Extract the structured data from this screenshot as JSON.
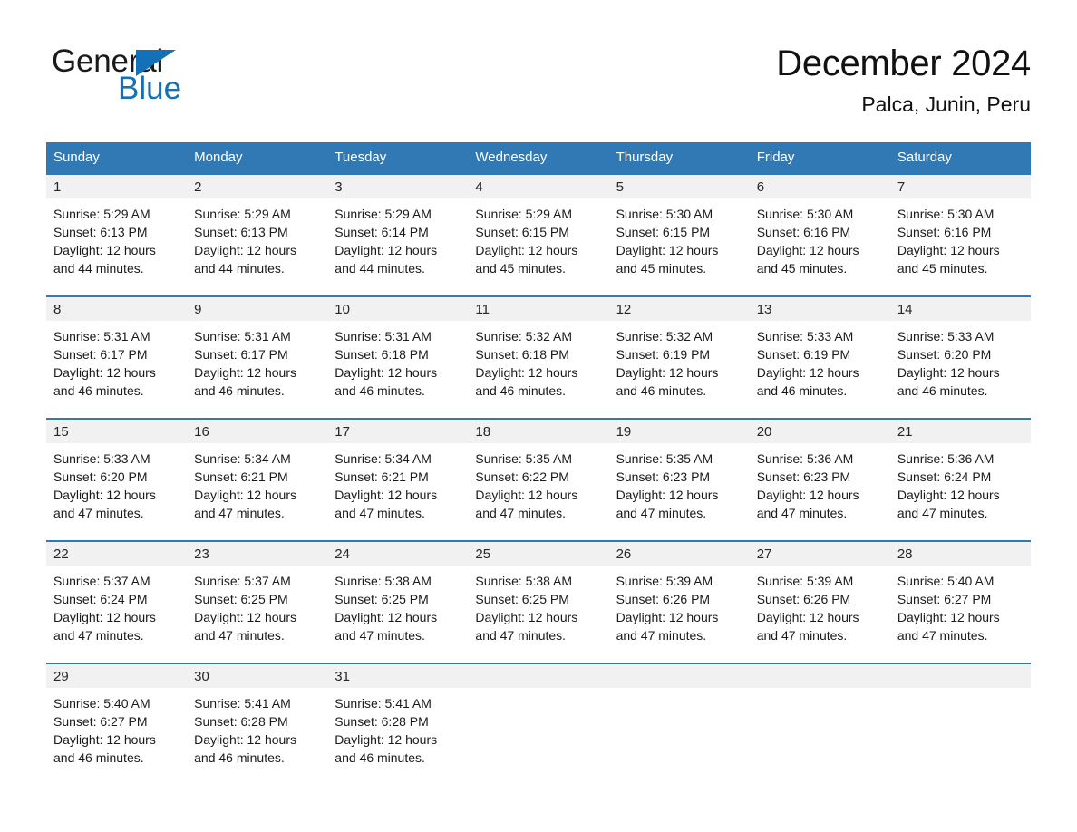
{
  "brand": {
    "name_part1": "General",
    "name_part2": "Blue",
    "triangle_color": "#1371b8",
    "text_color": "#1a1a1a"
  },
  "header": {
    "title": "December 2024",
    "subtitle": "Palca, Junin, Peru"
  },
  "theme": {
    "header_blue": "#3179b5",
    "daynum_band_gray": "#f1f1f1",
    "page_background": "#ffffff",
    "text_color": "#1a1a1a"
  },
  "weekday_headers": [
    "Sunday",
    "Monday",
    "Tuesday",
    "Wednesday",
    "Thursday",
    "Friday",
    "Saturday"
  ],
  "weeks": [
    [
      {
        "day": "1",
        "sunrise": "Sunrise: 5:29 AM",
        "sunset": "Sunset: 6:13 PM",
        "daylight_line1": "Daylight: 12 hours",
        "daylight_line2": "and 44 minutes."
      },
      {
        "day": "2",
        "sunrise": "Sunrise: 5:29 AM",
        "sunset": "Sunset: 6:13 PM",
        "daylight_line1": "Daylight: 12 hours",
        "daylight_line2": "and 44 minutes."
      },
      {
        "day": "3",
        "sunrise": "Sunrise: 5:29 AM",
        "sunset": "Sunset: 6:14 PM",
        "daylight_line1": "Daylight: 12 hours",
        "daylight_line2": "and 44 minutes."
      },
      {
        "day": "4",
        "sunrise": "Sunrise: 5:29 AM",
        "sunset": "Sunset: 6:15 PM",
        "daylight_line1": "Daylight: 12 hours",
        "daylight_line2": "and 45 minutes."
      },
      {
        "day": "5",
        "sunrise": "Sunrise: 5:30 AM",
        "sunset": "Sunset: 6:15 PM",
        "daylight_line1": "Daylight: 12 hours",
        "daylight_line2": "and 45 minutes."
      },
      {
        "day": "6",
        "sunrise": "Sunrise: 5:30 AM",
        "sunset": "Sunset: 6:16 PM",
        "daylight_line1": "Daylight: 12 hours",
        "daylight_line2": "and 45 minutes."
      },
      {
        "day": "7",
        "sunrise": "Sunrise: 5:30 AM",
        "sunset": "Sunset: 6:16 PM",
        "daylight_line1": "Daylight: 12 hours",
        "daylight_line2": "and 45 minutes."
      }
    ],
    [
      {
        "day": "8",
        "sunrise": "Sunrise: 5:31 AM",
        "sunset": "Sunset: 6:17 PM",
        "daylight_line1": "Daylight: 12 hours",
        "daylight_line2": "and 46 minutes."
      },
      {
        "day": "9",
        "sunrise": "Sunrise: 5:31 AM",
        "sunset": "Sunset: 6:17 PM",
        "daylight_line1": "Daylight: 12 hours",
        "daylight_line2": "and 46 minutes."
      },
      {
        "day": "10",
        "sunrise": "Sunrise: 5:31 AM",
        "sunset": "Sunset: 6:18 PM",
        "daylight_line1": "Daylight: 12 hours",
        "daylight_line2": "and 46 minutes."
      },
      {
        "day": "11",
        "sunrise": "Sunrise: 5:32 AM",
        "sunset": "Sunset: 6:18 PM",
        "daylight_line1": "Daylight: 12 hours",
        "daylight_line2": "and 46 minutes."
      },
      {
        "day": "12",
        "sunrise": "Sunrise: 5:32 AM",
        "sunset": "Sunset: 6:19 PM",
        "daylight_line1": "Daylight: 12 hours",
        "daylight_line2": "and 46 minutes."
      },
      {
        "day": "13",
        "sunrise": "Sunrise: 5:33 AM",
        "sunset": "Sunset: 6:19 PM",
        "daylight_line1": "Daylight: 12 hours",
        "daylight_line2": "and 46 minutes."
      },
      {
        "day": "14",
        "sunrise": "Sunrise: 5:33 AM",
        "sunset": "Sunset: 6:20 PM",
        "daylight_line1": "Daylight: 12 hours",
        "daylight_line2": "and 46 minutes."
      }
    ],
    [
      {
        "day": "15",
        "sunrise": "Sunrise: 5:33 AM",
        "sunset": "Sunset: 6:20 PM",
        "daylight_line1": "Daylight: 12 hours",
        "daylight_line2": "and 47 minutes."
      },
      {
        "day": "16",
        "sunrise": "Sunrise: 5:34 AM",
        "sunset": "Sunset: 6:21 PM",
        "daylight_line1": "Daylight: 12 hours",
        "daylight_line2": "and 47 minutes."
      },
      {
        "day": "17",
        "sunrise": "Sunrise: 5:34 AM",
        "sunset": "Sunset: 6:21 PM",
        "daylight_line1": "Daylight: 12 hours",
        "daylight_line2": "and 47 minutes."
      },
      {
        "day": "18",
        "sunrise": "Sunrise: 5:35 AM",
        "sunset": "Sunset: 6:22 PM",
        "daylight_line1": "Daylight: 12 hours",
        "daylight_line2": "and 47 minutes."
      },
      {
        "day": "19",
        "sunrise": "Sunrise: 5:35 AM",
        "sunset": "Sunset: 6:23 PM",
        "daylight_line1": "Daylight: 12 hours",
        "daylight_line2": "and 47 minutes."
      },
      {
        "day": "20",
        "sunrise": "Sunrise: 5:36 AM",
        "sunset": "Sunset: 6:23 PM",
        "daylight_line1": "Daylight: 12 hours",
        "daylight_line2": "and 47 minutes."
      },
      {
        "day": "21",
        "sunrise": "Sunrise: 5:36 AM",
        "sunset": "Sunset: 6:24 PM",
        "daylight_line1": "Daylight: 12 hours",
        "daylight_line2": "and 47 minutes."
      }
    ],
    [
      {
        "day": "22",
        "sunrise": "Sunrise: 5:37 AM",
        "sunset": "Sunset: 6:24 PM",
        "daylight_line1": "Daylight: 12 hours",
        "daylight_line2": "and 47 minutes."
      },
      {
        "day": "23",
        "sunrise": "Sunrise: 5:37 AM",
        "sunset": "Sunset: 6:25 PM",
        "daylight_line1": "Daylight: 12 hours",
        "daylight_line2": "and 47 minutes."
      },
      {
        "day": "24",
        "sunrise": "Sunrise: 5:38 AM",
        "sunset": "Sunset: 6:25 PM",
        "daylight_line1": "Daylight: 12 hours",
        "daylight_line2": "and 47 minutes."
      },
      {
        "day": "25",
        "sunrise": "Sunrise: 5:38 AM",
        "sunset": "Sunset: 6:25 PM",
        "daylight_line1": "Daylight: 12 hours",
        "daylight_line2": "and 47 minutes."
      },
      {
        "day": "26",
        "sunrise": "Sunrise: 5:39 AM",
        "sunset": "Sunset: 6:26 PM",
        "daylight_line1": "Daylight: 12 hours",
        "daylight_line2": "and 47 minutes."
      },
      {
        "day": "27",
        "sunrise": "Sunrise: 5:39 AM",
        "sunset": "Sunset: 6:26 PM",
        "daylight_line1": "Daylight: 12 hours",
        "daylight_line2": "and 47 minutes."
      },
      {
        "day": "28",
        "sunrise": "Sunrise: 5:40 AM",
        "sunset": "Sunset: 6:27 PM",
        "daylight_line1": "Daylight: 12 hours",
        "daylight_line2": "and 47 minutes."
      }
    ],
    [
      {
        "day": "29",
        "sunrise": "Sunrise: 5:40 AM",
        "sunset": "Sunset: 6:27 PM",
        "daylight_line1": "Daylight: 12 hours",
        "daylight_line2": "and 46 minutes."
      },
      {
        "day": "30",
        "sunrise": "Sunrise: 5:41 AM",
        "sunset": "Sunset: 6:28 PM",
        "daylight_line1": "Daylight: 12 hours",
        "daylight_line2": "and 46 minutes."
      },
      {
        "day": "31",
        "sunrise": "Sunrise: 5:41 AM",
        "sunset": "Sunset: 6:28 PM",
        "daylight_line1": "Daylight: 12 hours",
        "daylight_line2": "and 46 minutes."
      },
      {
        "day": "",
        "sunrise": "",
        "sunset": "",
        "daylight_line1": "",
        "daylight_line2": ""
      },
      {
        "day": "",
        "sunrise": "",
        "sunset": "",
        "daylight_line1": "",
        "daylight_line2": ""
      },
      {
        "day": "",
        "sunrise": "",
        "sunset": "",
        "daylight_line1": "",
        "daylight_line2": ""
      },
      {
        "day": "",
        "sunrise": "",
        "sunset": "",
        "daylight_line1": "",
        "daylight_line2": ""
      }
    ]
  ]
}
